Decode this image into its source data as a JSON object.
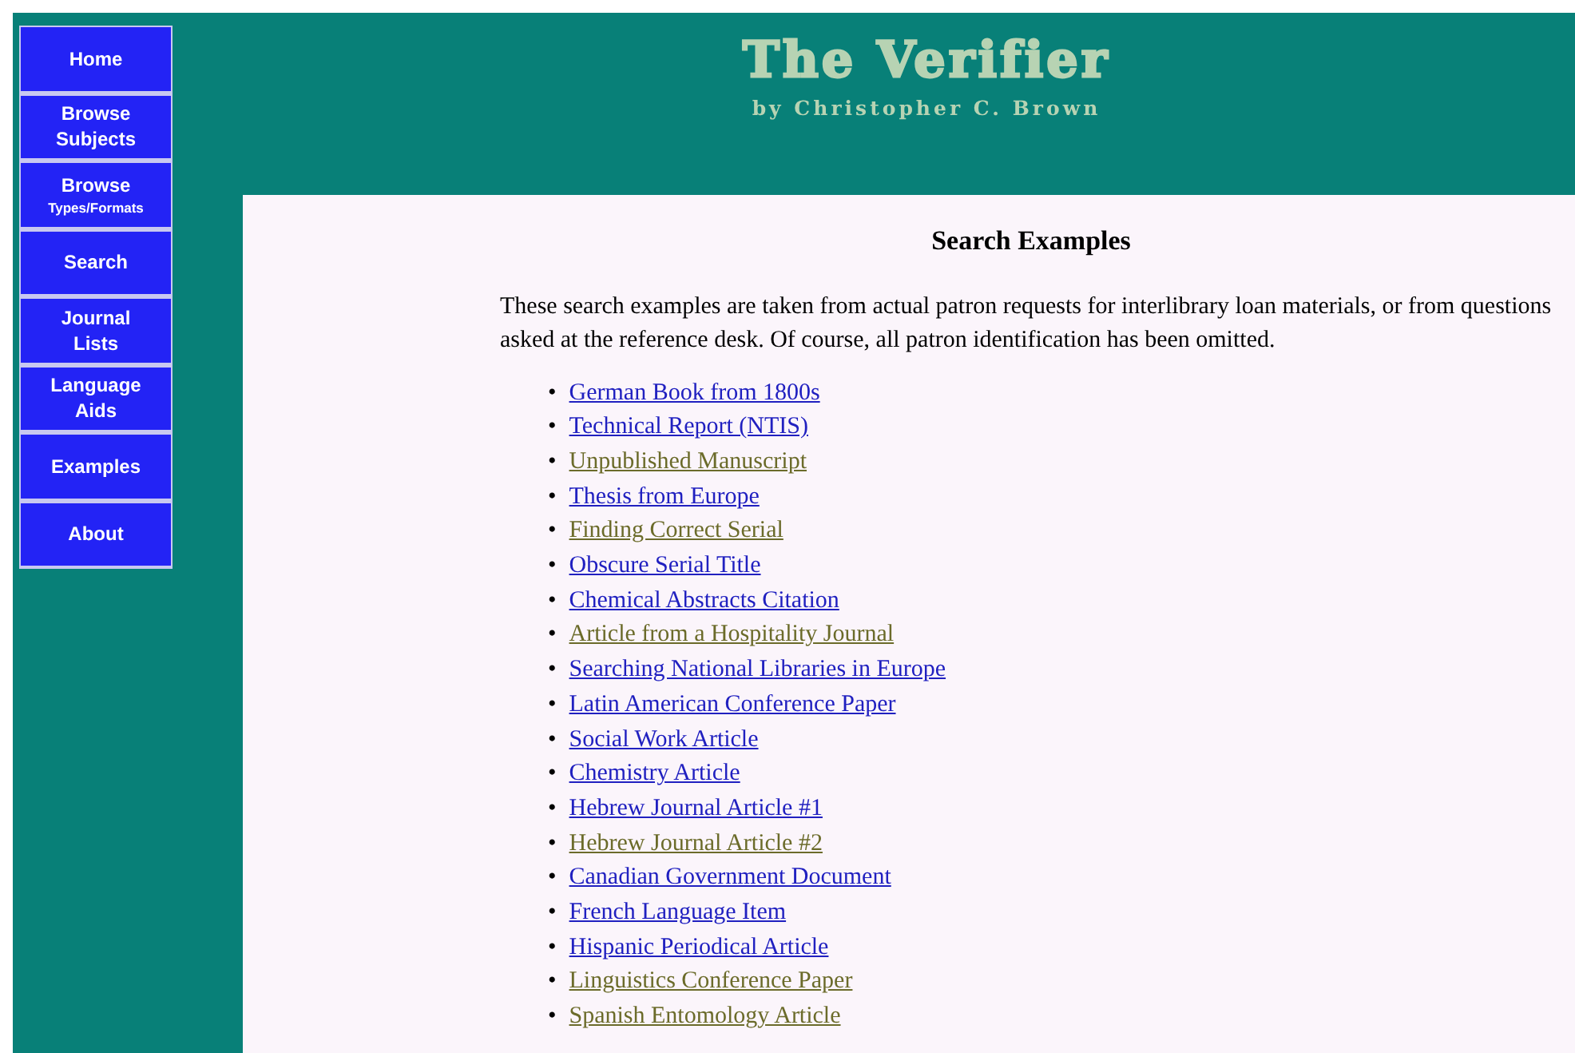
{
  "nav": [
    {
      "label": "Home",
      "selected": false
    },
    {
      "label": "Browse",
      "sublabel": "Subjects",
      "selected": false
    },
    {
      "label": "Browse",
      "sublabel_small": "Types/Formats",
      "selected": false
    },
    {
      "label": "Search",
      "selected": false
    },
    {
      "label": "Journal",
      "sublabel": "Lists",
      "selected": false
    },
    {
      "label": "Language",
      "sublabel": "Aids",
      "selected": false
    },
    {
      "label": "Examples",
      "selected": false
    },
    {
      "label": "About",
      "selected": false
    }
  ],
  "header": {
    "title": "The Verifier",
    "byline": "by Christopher C. Brown"
  },
  "content": {
    "heading": "Search Examples",
    "intro": "These search examples are taken from actual patron requests for interlibrary loan materials, or from questions asked at the reference desk. Of course, all patron identification has been omitted.",
    "bullet": "•",
    "examples": [
      {
        "label": "German Book from 1800s",
        "visited": false
      },
      {
        "label": "Technical Report (NTIS)",
        "visited": false
      },
      {
        "label": "Unpublished Manuscript",
        "visited": true
      },
      {
        "label": "Thesis from Europe",
        "visited": false
      },
      {
        "label": "Finding Correct Serial",
        "visited": true
      },
      {
        "label": "Obscure Serial Title",
        "visited": false
      },
      {
        "label": "Chemical Abstracts Citation",
        "visited": false
      },
      {
        "label": "Article from a Hospitality Journal",
        "visited": true
      },
      {
        "label": "Searching National Libraries in Europe",
        "visited": false
      },
      {
        "label": "Latin American Conference Paper",
        "visited": false
      },
      {
        "label": "Social Work Article",
        "visited": false
      },
      {
        "label": "Chemistry Article",
        "visited": false
      },
      {
        "label": "Hebrew Journal Article #1",
        "visited": false
      },
      {
        "label": "Hebrew Journal Article #2",
        "visited": true
      },
      {
        "label": "Canadian Government Document",
        "visited": false
      },
      {
        "label": "French Language Item",
        "visited": false
      },
      {
        "label": "Hispanic Periodical Article",
        "visited": false
      },
      {
        "label": "Linguistics Conference Paper",
        "visited": true
      },
      {
        "label": "Spanish Entomology Article",
        "visited": true
      }
    ]
  }
}
